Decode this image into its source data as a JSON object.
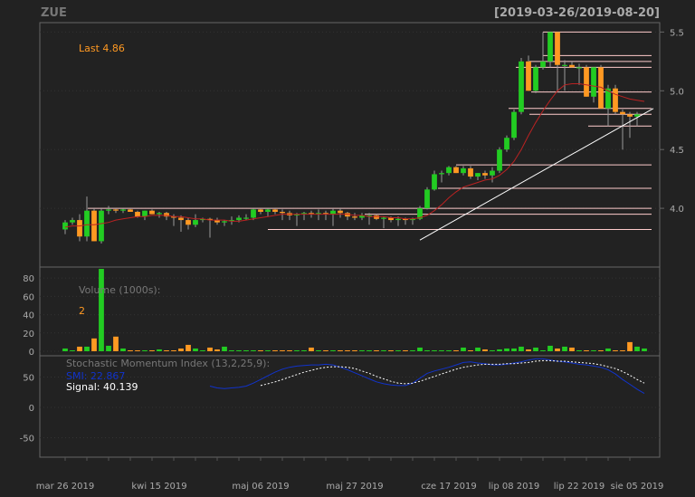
{
  "header": {
    "symbol": "ZUE",
    "date_range": "[2019-03-26/2019-08-20]"
  },
  "colors": {
    "background": "#222222",
    "panel_border": "#666666",
    "grid": "#333333",
    "axis_text": "#aaaaaa",
    "up": "#22cc22",
    "down": "#ff9922",
    "wick": "#999999",
    "ma_line": "#bb2222",
    "trendline": "#ffffff",
    "hline": "#ffcccc",
    "smi_line": "#1133cc",
    "signal_line": "#ffffff",
    "last_label": "#ff9922"
  },
  "x_labels": [
    "mar 26 2019",
    "kwi 15 2019",
    "maj 06 2019",
    "maj 27 2019",
    "cze 17 2019",
    "lip 08 2019",
    "lip 22 2019",
    "sie 05 2019"
  ],
  "chart_data": [
    {
      "type": "candlestick",
      "title": "ZUE",
      "last_label": "Last 4.86",
      "ylim": [
        3.5,
        5.58
      ],
      "y_ticks": [
        4.0,
        4.5,
        5.0,
        5.5
      ],
      "y_tick_labels": [
        "4.0",
        "4.5",
        "5.0",
        "5.5"
      ],
      "candles": [
        {
          "o": 3.82,
          "h": 3.9,
          "l": 3.78,
          "c": 3.88
        },
        {
          "o": 3.88,
          "h": 3.92,
          "l": 3.86,
          "c": 3.9
        },
        {
          "o": 3.9,
          "h": 3.95,
          "l": 3.72,
          "c": 3.76
        },
        {
          "o": 3.76,
          "h": 4.1,
          "l": 3.72,
          "c": 3.98
        },
        {
          "o": 3.98,
          "h": 4.0,
          "l": 3.72,
          "c": 3.72
        },
        {
          "o": 3.72,
          "h": 4.0,
          "l": 3.7,
          "c": 3.98
        },
        {
          "o": 3.98,
          "h": 4.02,
          "l": 3.95,
          "c": 3.99
        },
        {
          "o": 3.99,
          "h": 4.0,
          "l": 3.96,
          "c": 3.98
        },
        {
          "o": 3.98,
          "h": 4.0,
          "l": 3.96,
          "c": 3.99
        },
        {
          "o": 3.99,
          "h": 4.0,
          "l": 3.97,
          "c": 3.97
        },
        {
          "o": 3.97,
          "h": 3.98,
          "l": 3.92,
          "c": 3.93
        },
        {
          "o": 3.93,
          "h": 3.98,
          "l": 3.9,
          "c": 3.98
        },
        {
          "o": 3.98,
          "h": 3.99,
          "l": 3.95,
          "c": 3.95
        },
        {
          "o": 3.95,
          "h": 3.97,
          "l": 3.92,
          "c": 3.96
        },
        {
          "o": 3.96,
          "h": 3.97,
          "l": 3.9,
          "c": 3.93
        },
        {
          "o": 3.93,
          "h": 3.95,
          "l": 3.85,
          "c": 3.92
        },
        {
          "o": 3.92,
          "h": 3.94,
          "l": 3.8,
          "c": 3.9
        },
        {
          "o": 3.9,
          "h": 3.92,
          "l": 3.82,
          "c": 3.86
        },
        {
          "o": 3.86,
          "h": 3.95,
          "l": 3.84,
          "c": 3.9
        },
        {
          "o": 3.9,
          "h": 3.92,
          "l": 3.88,
          "c": 3.91
        },
        {
          "o": 3.91,
          "h": 3.92,
          "l": 3.75,
          "c": 3.9
        },
        {
          "o": 3.9,
          "h": 3.92,
          "l": 3.86,
          "c": 3.88
        },
        {
          "o": 3.88,
          "h": 3.9,
          "l": 3.85,
          "c": 3.89
        },
        {
          "o": 3.89,
          "h": 3.93,
          "l": 3.86,
          "c": 3.9
        },
        {
          "o": 3.9,
          "h": 3.94,
          "l": 3.88,
          "c": 3.92
        },
        {
          "o": 3.92,
          "h": 3.95,
          "l": 3.9,
          "c": 3.92
        },
        {
          "o": 3.92,
          "h": 4.0,
          "l": 3.9,
          "c": 3.99
        },
        {
          "o": 3.99,
          "h": 4.0,
          "l": 3.95,
          "c": 3.97
        },
        {
          "o": 3.97,
          "h": 4.0,
          "l": 3.93,
          "c": 3.99
        },
        {
          "o": 3.99,
          "h": 4.0,
          "l": 3.95,
          "c": 3.97
        },
        {
          "o": 3.97,
          "h": 3.99,
          "l": 3.9,
          "c": 3.96
        },
        {
          "o": 3.96,
          "h": 3.98,
          "l": 3.9,
          "c": 3.94
        },
        {
          "o": 3.94,
          "h": 3.96,
          "l": 3.85,
          "c": 3.95
        },
        {
          "o": 3.95,
          "h": 3.97,
          "l": 3.9,
          "c": 3.96
        },
        {
          "o": 3.96,
          "h": 3.98,
          "l": 3.92,
          "c": 3.95
        },
        {
          "o": 3.95,
          "h": 3.99,
          "l": 3.9,
          "c": 3.96
        },
        {
          "o": 3.96,
          "h": 3.98,
          "l": 3.9,
          "c": 3.95
        },
        {
          "o": 3.95,
          "h": 4.0,
          "l": 3.85,
          "c": 3.98
        },
        {
          "o": 3.98,
          "h": 4.0,
          "l": 3.92,
          "c": 3.96
        },
        {
          "o": 3.96,
          "h": 3.97,
          "l": 3.9,
          "c": 3.93
        },
        {
          "o": 3.93,
          "h": 3.96,
          "l": 3.9,
          "c": 3.92
        },
        {
          "o": 3.92,
          "h": 3.96,
          "l": 3.9,
          "c": 3.94
        },
        {
          "o": 3.94,
          "h": 3.96,
          "l": 3.86,
          "c": 3.94
        },
        {
          "o": 3.94,
          "h": 3.95,
          "l": 3.9,
          "c": 3.91
        },
        {
          "o": 3.91,
          "h": 3.93,
          "l": 3.83,
          "c": 3.92
        },
        {
          "o": 3.92,
          "h": 3.93,
          "l": 3.88,
          "c": 3.9
        },
        {
          "o": 3.9,
          "h": 3.93,
          "l": 3.85,
          "c": 3.91
        },
        {
          "o": 3.91,
          "h": 3.92,
          "l": 3.86,
          "c": 3.9
        },
        {
          "o": 3.9,
          "h": 3.92,
          "l": 3.86,
          "c": 3.91
        },
        {
          "o": 3.91,
          "h": 4.02,
          "l": 3.9,
          "c": 4.0
        },
        {
          "o": 4.0,
          "h": 4.18,
          "l": 3.99,
          "c": 4.16
        },
        {
          "o": 4.16,
          "h": 4.32,
          "l": 4.15,
          "c": 4.29
        },
        {
          "o": 4.29,
          "h": 4.32,
          "l": 4.22,
          "c": 4.3
        },
        {
          "o": 4.3,
          "h": 4.36,
          "l": 4.28,
          "c": 4.35
        },
        {
          "o": 4.35,
          "h": 4.36,
          "l": 4.3,
          "c": 4.3
        },
        {
          "o": 4.3,
          "h": 4.36,
          "l": 4.28,
          "c": 4.34
        },
        {
          "o": 4.34,
          "h": 4.36,
          "l": 4.25,
          "c": 4.27
        },
        {
          "o": 4.27,
          "h": 4.3,
          "l": 4.24,
          "c": 4.3
        },
        {
          "o": 4.3,
          "h": 4.32,
          "l": 4.25,
          "c": 4.28
        },
        {
          "o": 4.28,
          "h": 4.35,
          "l": 4.22,
          "c": 4.32
        },
        {
          "o": 4.32,
          "h": 4.52,
          "l": 4.3,
          "c": 4.5
        },
        {
          "o": 4.5,
          "h": 4.62,
          "l": 4.48,
          "c": 4.6
        },
        {
          "o": 4.6,
          "h": 4.84,
          "l": 4.58,
          "c": 4.82
        },
        {
          "o": 4.82,
          "h": 5.28,
          "l": 4.8,
          "c": 5.25
        },
        {
          "o": 5.25,
          "h": 5.3,
          "l": 5.0,
          "c": 5.0
        },
        {
          "o": 5.0,
          "h": 5.22,
          "l": 4.98,
          "c": 5.2
        },
        {
          "o": 5.2,
          "h": 5.5,
          "l": 5.18,
          "c": 5.25
        },
        {
          "o": 5.25,
          "h": 5.5,
          "l": 5.2,
          "c": 5.5
        },
        {
          "o": 5.5,
          "h": 5.5,
          "l": 5.0,
          "c": 5.22
        },
        {
          "o": 5.22,
          "h": 5.26,
          "l": 5.0,
          "c": 5.22
        },
        {
          "o": 5.22,
          "h": 5.25,
          "l": 5.2,
          "c": 5.2
        },
        {
          "o": 5.2,
          "h": 5.23,
          "l": 5.05,
          "c": 5.2
        },
        {
          "o": 5.2,
          "h": 5.22,
          "l": 4.95,
          "c": 4.95
        },
        {
          "o": 4.95,
          "h": 5.2,
          "l": 4.9,
          "c": 5.2
        },
        {
          "o": 5.2,
          "h": 5.22,
          "l": 4.85,
          "c": 4.85
        },
        {
          "o": 4.85,
          "h": 5.05,
          "l": 4.7,
          "c": 5.02
        },
        {
          "o": 5.02,
          "h": 5.05,
          "l": 4.8,
          "c": 4.82
        },
        {
          "o": 4.82,
          "h": 4.84,
          "l": 4.5,
          "c": 4.8
        },
        {
          "o": 4.8,
          "h": 4.82,
          "l": 4.6,
          "c": 4.78
        },
        {
          "o": 4.78,
          "h": 4.82,
          "l": 4.7,
          "c": 4.8
        }
      ],
      "ma": [
        3.84,
        3.85,
        3.85,
        3.86,
        3.86,
        3.87,
        3.88,
        3.9,
        3.91,
        3.92,
        3.93,
        3.93,
        3.94,
        3.94,
        3.94,
        3.93,
        3.93,
        3.92,
        3.91,
        3.91,
        3.9,
        3.9,
        3.9,
        3.89,
        3.89,
        3.9,
        3.91,
        3.92,
        3.93,
        3.94,
        3.95,
        3.95,
        3.95,
        3.95,
        3.95,
        3.95,
        3.95,
        3.95,
        3.95,
        3.95,
        3.94,
        3.94,
        3.93,
        3.93,
        3.93,
        3.92,
        3.92,
        3.91,
        3.91,
        3.92,
        3.94,
        3.98,
        4.03,
        4.09,
        4.14,
        4.18,
        4.2,
        4.22,
        4.24,
        4.25,
        4.28,
        4.33,
        4.4,
        4.5,
        4.62,
        4.73,
        4.83,
        4.92,
        5.0,
        5.05,
        5.06,
        5.06,
        5.05,
        5.04,
        5.03,
        5.0,
        4.97,
        4.95,
        4.93,
        4.92,
        4.91
      ],
      "hlines": [
        5.5,
        5.3,
        5.25,
        5.2,
        4.99,
        4.85,
        4.8,
        4.7,
        4.37,
        4.17,
        4.0,
        3.95,
        3.82
      ],
      "trendline": [
        [
          49,
          3.73
        ],
        [
          80,
          4.85
        ]
      ]
    },
    {
      "type": "bar",
      "title": "Volume (1000s):",
      "last_value": "2",
      "ylim": [
        0,
        92
      ],
      "y_ticks": [
        0,
        20,
        40,
        60,
        80
      ],
      "y_tick_labels": [
        "0",
        "20",
        "40",
        "60",
        "80"
      ],
      "values": [
        3,
        1,
        5,
        5,
        14,
        90,
        6,
        16,
        3,
        1,
        1,
        1,
        1,
        2,
        1,
        1,
        3,
        7,
        3,
        1,
        4,
        2,
        5,
        1,
        1,
        1,
        1,
        1,
        1,
        1,
        1,
        1,
        1,
        1,
        4,
        1,
        1,
        1,
        1,
        1,
        1,
        1,
        1,
        1,
        1,
        1,
        1,
        1,
        1,
        4,
        1,
        1,
        1,
        1,
        1,
        4,
        1,
        4,
        2,
        1,
        2,
        3,
        3,
        5,
        2,
        4,
        1,
        6,
        3,
        5,
        4,
        1,
        1,
        1,
        1,
        3,
        1,
        1,
        10,
        5,
        3
      ]
    },
    {
      "type": "line",
      "title": "Stochastic Momentum Index (13,2,25,9):",
      "smi_label": "SMI: 22.867",
      "signal_label": "Signal: 40.139",
      "ylim": [
        -82,
        85
      ],
      "y_ticks": [
        -50,
        0,
        50
      ],
      "y_tick_labels": [
        "-50",
        "0",
        "50"
      ],
      "smi": [
        null,
        null,
        null,
        null,
        null,
        null,
        null,
        null,
        null,
        null,
        null,
        null,
        null,
        null,
        null,
        null,
        null,
        null,
        null,
        null,
        35,
        32,
        31,
        32,
        33,
        35,
        40,
        46,
        52,
        58,
        63,
        66,
        68,
        69,
        70,
        70,
        71,
        70,
        66,
        62,
        57,
        52,
        47,
        42,
        39,
        37,
        36,
        36,
        40,
        48,
        56,
        60,
        63,
        66,
        70,
        74,
        75,
        73,
        72,
        70,
        70,
        71,
        73,
        75,
        78,
        80,
        80,
        78,
        76,
        75,
        73,
        71,
        70,
        68,
        66,
        62,
        55,
        46,
        38,
        30,
        23
      ],
      "signal": [
        null,
        null,
        null,
        null,
        null,
        null,
        null,
        null,
        null,
        null,
        null,
        null,
        null,
        null,
        null,
        null,
        null,
        null,
        null,
        null,
        null,
        null,
        null,
        null,
        null,
        null,
        null,
        36,
        39,
        42,
        46,
        50,
        54,
        58,
        61,
        64,
        66,
        67,
        67,
        66,
        64,
        60,
        56,
        51,
        47,
        43,
        40,
        39,
        40,
        43,
        47,
        51,
        55,
        59,
        63,
        66,
        68,
        70,
        71,
        71,
        71,
        72,
        72,
        73,
        74,
        76,
        77,
        77,
        76,
        76,
        75,
        74,
        73,
        72,
        70,
        67,
        64,
        59,
        53,
        46,
        40
      ]
    }
  ]
}
